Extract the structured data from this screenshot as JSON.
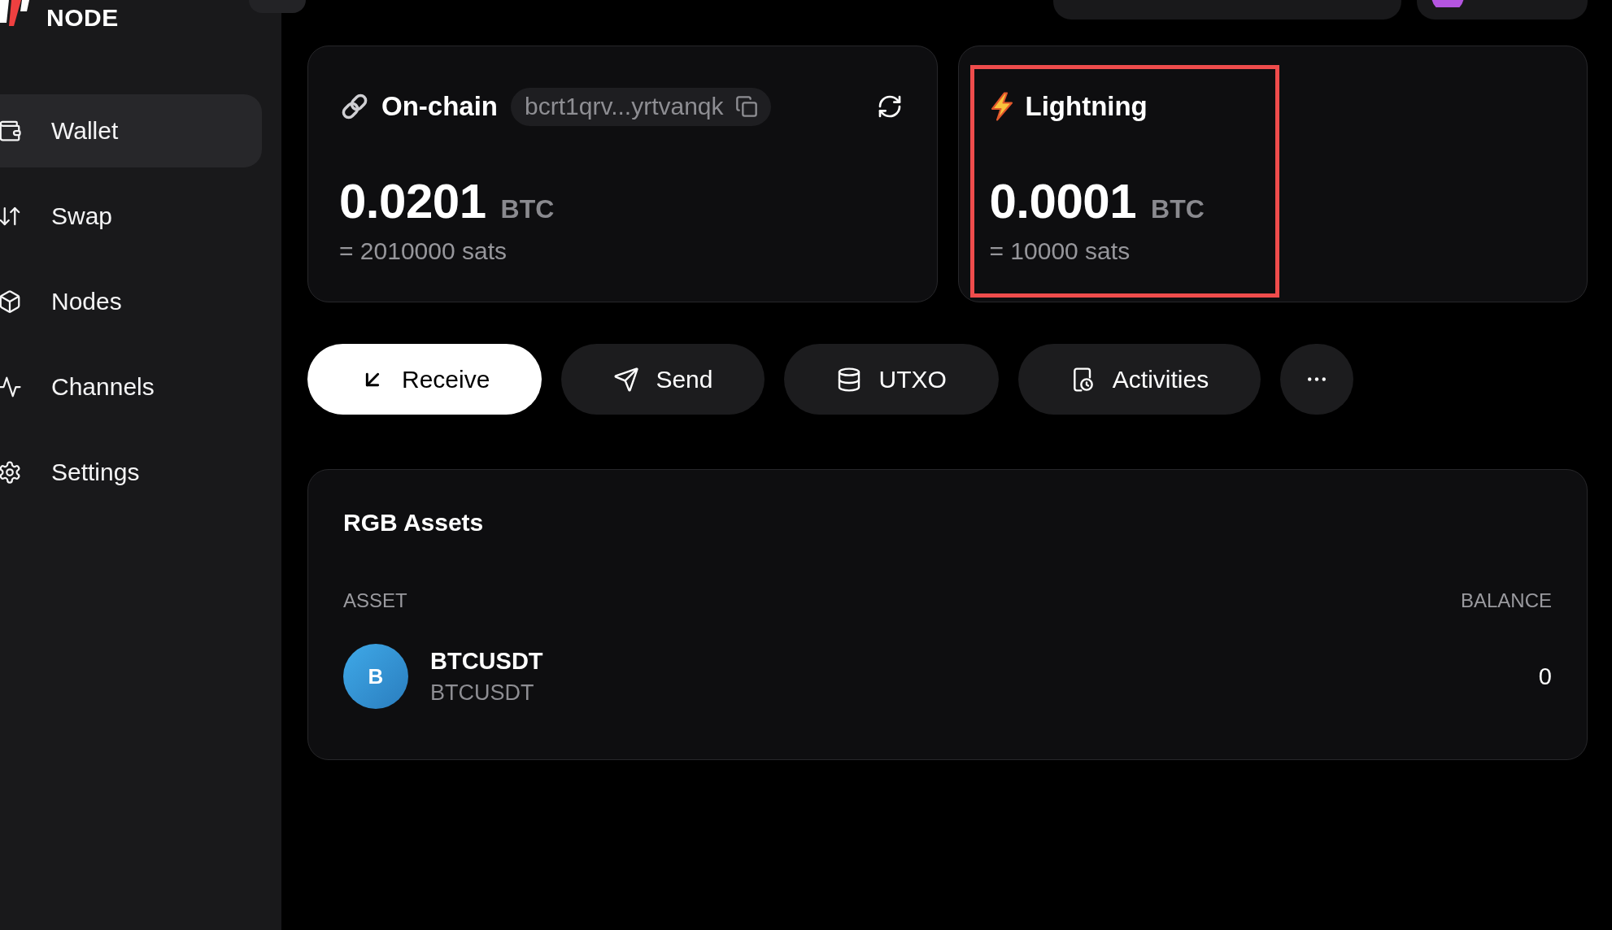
{
  "sidebar": {
    "logo_text": "NODE",
    "items": [
      {
        "label": "Wallet",
        "selected": true
      },
      {
        "label": "Swap",
        "selected": false
      },
      {
        "label": "Nodes",
        "selected": false
      },
      {
        "label": "Channels",
        "selected": false
      },
      {
        "label": "Settings",
        "selected": false
      }
    ]
  },
  "balances": [
    {
      "kind": "onchain",
      "title": "On-chain",
      "address": "bcrt1qrv...yrtvanqk",
      "amount": "0.0201",
      "unit": "BTC",
      "sats": "= 2010000 sats",
      "highlighted": false
    },
    {
      "kind": "lightning",
      "title": "Lightning",
      "amount": "0.0001",
      "unit": "BTC",
      "sats": "= 10000 sats",
      "highlighted": true
    }
  ],
  "actions": [
    {
      "label": "Receive",
      "primary": true
    },
    {
      "label": "Send",
      "primary": false
    },
    {
      "label": "UTXO",
      "primary": false
    },
    {
      "label": "Activities",
      "primary": false
    },
    {
      "primary": false
    }
  ],
  "assets": {
    "title": "RGB Assets",
    "columns": [
      "ASSET",
      "BALANCE"
    ],
    "rows": [
      {
        "initial": "B",
        "name": "BTCUSDT",
        "ticker": "BTCUSDT",
        "balance": "0"
      }
    ]
  }
}
